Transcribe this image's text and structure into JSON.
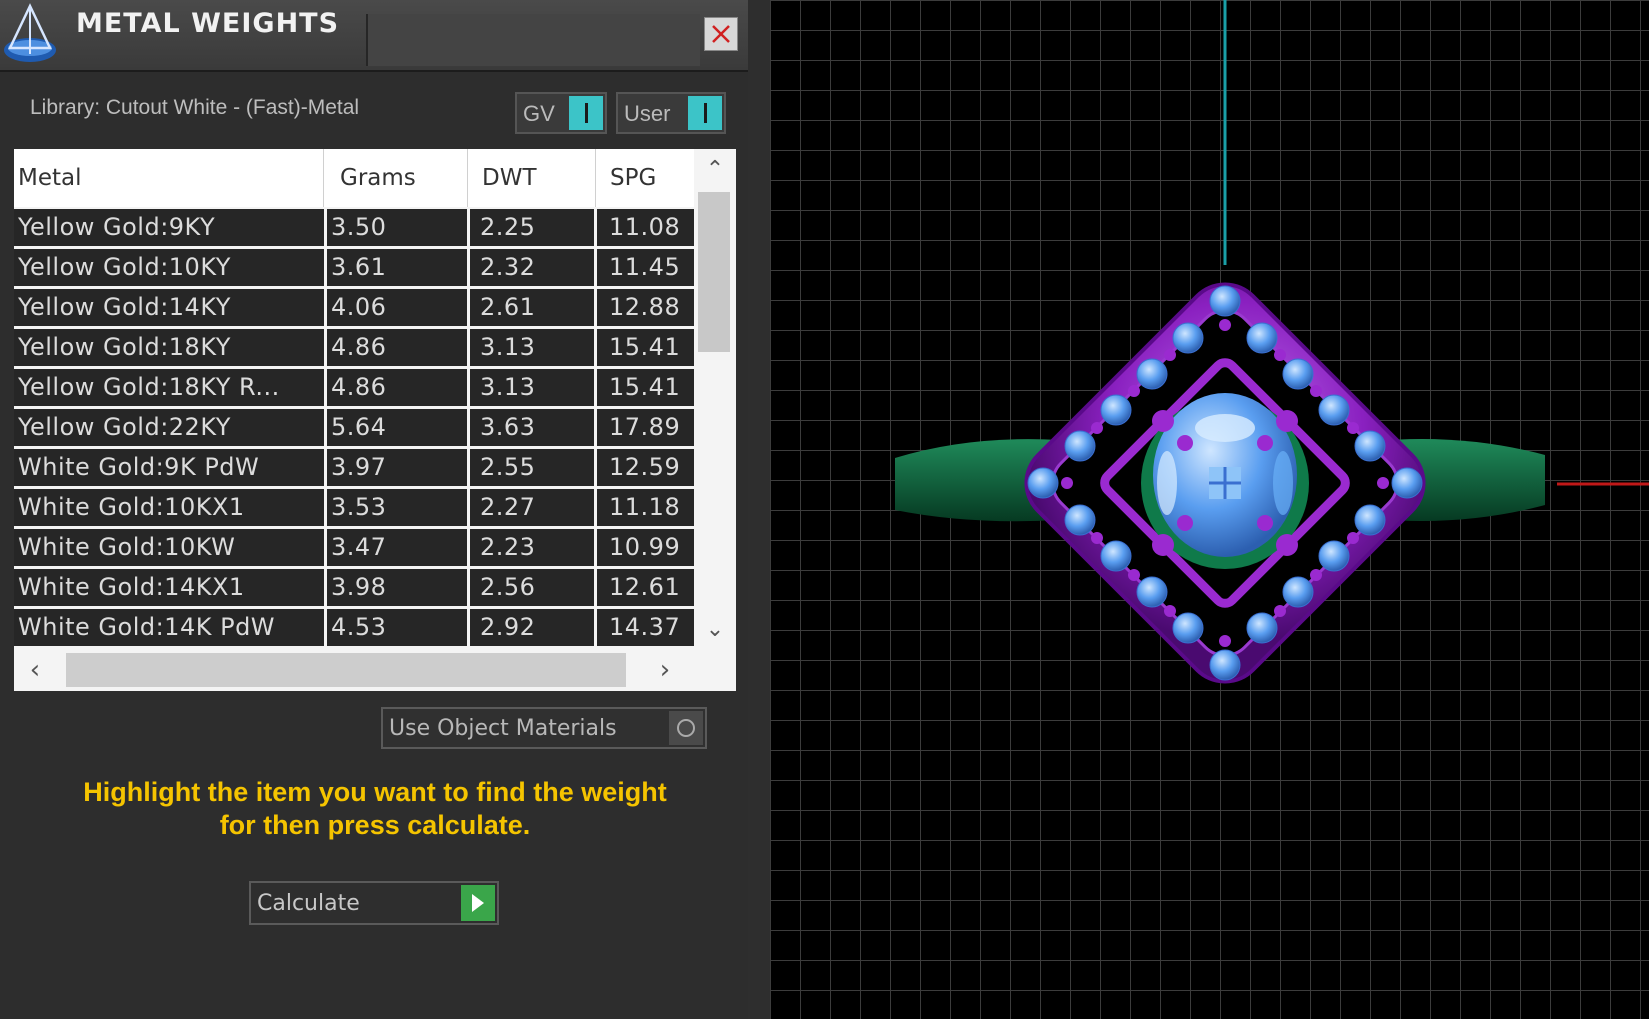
{
  "window": {
    "title": "METAL WEIGHTS",
    "close_icon": "close-icon"
  },
  "library": {
    "label": "Library: Cutout White - (Fast)-Metal"
  },
  "toggles": {
    "gv": "GV",
    "user": "User",
    "accent": "#3cc4c8"
  },
  "table": {
    "columns": [
      "Metal",
      "Grams",
      "DWT",
      "SPG"
    ],
    "rows": [
      [
        "Yellow Gold:9KY",
        "3.50",
        "2.25",
        "11.08"
      ],
      [
        "Yellow Gold:10KY",
        "3.61",
        "2.32",
        "11.45"
      ],
      [
        "Yellow Gold:14KY",
        "4.06",
        "2.61",
        "12.88"
      ],
      [
        "Yellow Gold:18KY",
        "4.86",
        "3.13",
        "15.41"
      ],
      [
        "Yellow Gold:18KY R...",
        "4.86",
        "3.13",
        "15.41"
      ],
      [
        "Yellow Gold:22KY",
        "5.64",
        "3.63",
        "17.89"
      ],
      [
        "White Gold:9K PdW",
        "3.97",
        "2.55",
        "12.59"
      ],
      [
        "White Gold:10KX1",
        "3.53",
        "2.27",
        "11.18"
      ],
      [
        "White Gold:10KW",
        "3.47",
        "2.23",
        "10.99"
      ],
      [
        "White Gold:14KX1",
        "3.98",
        "2.56",
        "12.61"
      ],
      [
        "White Gold:14K PdW",
        "4.53",
        "2.92",
        "14.37"
      ]
    ]
  },
  "options": {
    "use_object_materials": "Use Object Materials"
  },
  "instructions": {
    "line1": "Highlight the item you want to find the weight",
    "line2": "for then press calculate.",
    "color": "#f5c400"
  },
  "actions": {
    "calculate": "Calculate",
    "calculate_color": "#3aa64a"
  },
  "viewport": {
    "axis_vertical_color": "#1aa0a8",
    "axis_horizontal_color": "#c01818",
    "ring_metal_color": "#8a20c0",
    "stone_color": "#5a9ef0",
    "shank_color": "#0e5a3a"
  }
}
